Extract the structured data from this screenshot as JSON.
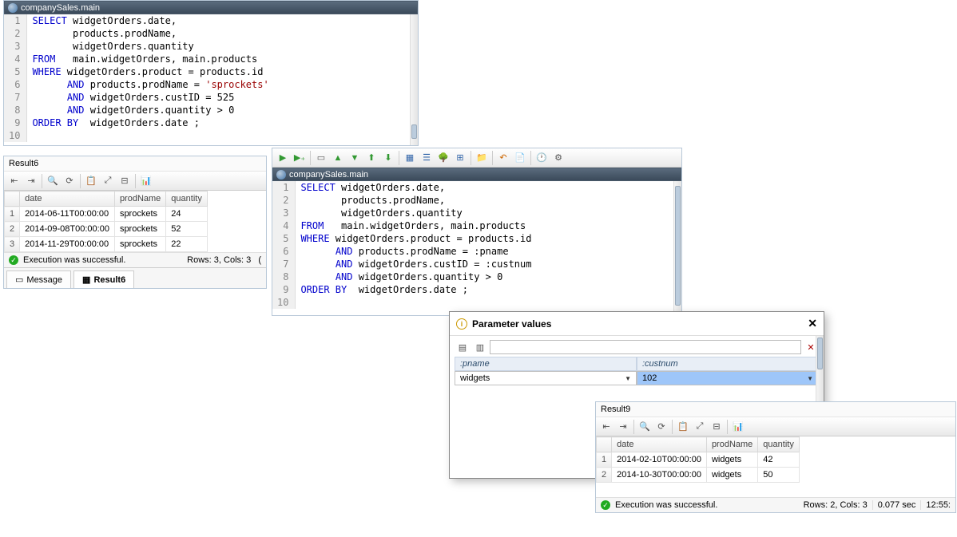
{
  "pane1": {
    "title": "companySales.main",
    "lines": [
      {
        "n": "1",
        "seg": [
          [
            "kw",
            "SELECT"
          ],
          [
            "",
            " widgetOrders.date,"
          ]
        ]
      },
      {
        "n": "2",
        "seg": [
          [
            "",
            "       products.prodName,"
          ]
        ]
      },
      {
        "n": "3",
        "seg": [
          [
            "",
            "       widgetOrders.quantity"
          ]
        ]
      },
      {
        "n": "4",
        "seg": [
          [
            "kw",
            "FROM"
          ],
          [
            "",
            "   main.widgetOrders, main.products"
          ]
        ]
      },
      {
        "n": "5",
        "seg": [
          [
            "kw",
            "WHERE"
          ],
          [
            "",
            " widgetOrders.product = products.id"
          ]
        ]
      },
      {
        "n": "6",
        "seg": [
          [
            "",
            "      "
          ],
          [
            "kw",
            "AND"
          ],
          [
            "",
            " products.prodName = "
          ],
          [
            "str",
            "'sprockets'"
          ]
        ]
      },
      {
        "n": "7",
        "seg": [
          [
            "",
            "      "
          ],
          [
            "kw",
            "AND"
          ],
          [
            "",
            " widgetOrders.custID = 525"
          ]
        ]
      },
      {
        "n": "8",
        "seg": [
          [
            "",
            "      "
          ],
          [
            "kw",
            "AND"
          ],
          [
            "",
            " widgetOrders.quantity > 0"
          ]
        ]
      },
      {
        "n": "9",
        "seg": [
          [
            "kw",
            "ORDER BY"
          ],
          [
            "",
            "  widgetOrders.date ;"
          ]
        ]
      },
      {
        "n": "10",
        "seg": [
          [
            "",
            ""
          ]
        ]
      }
    ]
  },
  "result6": {
    "label": "Result6",
    "columns": [
      "date",
      "prodName",
      "quantity"
    ],
    "rows": [
      [
        "2014-06-11T00:00:00",
        "sprockets",
        "24"
      ],
      [
        "2014-09-08T00:00:00",
        "sprockets",
        "52"
      ],
      [
        "2014-11-29T00:00:00",
        "sprockets",
        "22"
      ]
    ],
    "status_text": "Execution was successful.",
    "footer_right": "Rows: 3, Cols: 3",
    "tab_message": "Message",
    "tab_result": "Result6"
  },
  "pane2": {
    "title": "companySales.main",
    "lines": [
      {
        "n": "1",
        "seg": [
          [
            "kw",
            "SELECT"
          ],
          [
            "",
            " widgetOrders.date,"
          ]
        ]
      },
      {
        "n": "2",
        "seg": [
          [
            "",
            "       products.prodName,"
          ]
        ]
      },
      {
        "n": "3",
        "seg": [
          [
            "",
            "       widgetOrders.quantity"
          ]
        ]
      },
      {
        "n": "4",
        "seg": [
          [
            "kw",
            "FROM"
          ],
          [
            "",
            "   main.widgetOrders, main.products"
          ]
        ]
      },
      {
        "n": "5",
        "seg": [
          [
            "kw",
            "WHERE"
          ],
          [
            "",
            " widgetOrders.product = products.id"
          ]
        ]
      },
      {
        "n": "6",
        "seg": [
          [
            "",
            "      "
          ],
          [
            "kw",
            "AND"
          ],
          [
            "",
            " products.prodName = :pname"
          ]
        ]
      },
      {
        "n": "7",
        "seg": [
          [
            "",
            "      "
          ],
          [
            "kw",
            "AND"
          ],
          [
            "",
            " widgetOrders.custID = :custnum"
          ]
        ]
      },
      {
        "n": "8",
        "seg": [
          [
            "",
            "      "
          ],
          [
            "kw",
            "AND"
          ],
          [
            "",
            " widgetOrders.quantity > 0"
          ]
        ]
      },
      {
        "n": "9",
        "seg": [
          [
            "kw",
            "ORDER BY"
          ],
          [
            "",
            "  widgetOrders.date ;"
          ]
        ]
      },
      {
        "n": "10",
        "seg": [
          [
            "",
            ""
          ]
        ]
      }
    ]
  },
  "param_dialog": {
    "title": "Parameter values",
    "headers": [
      ":pname",
      ":custnum"
    ],
    "values": [
      "widgets",
      "102"
    ]
  },
  "result9": {
    "label": "Result9",
    "columns": [
      "date",
      "prodName",
      "quantity"
    ],
    "rows": [
      [
        "2014-02-10T00:00:00",
        "widgets",
        "42"
      ],
      [
        "2014-10-30T00:00:00",
        "widgets",
        "50"
      ]
    ],
    "status_text": "Execution was successful.",
    "footer_mid": "Rows: 2, Cols: 3",
    "footer_time": "0.077 sec",
    "footer_ts": "12:55:"
  }
}
